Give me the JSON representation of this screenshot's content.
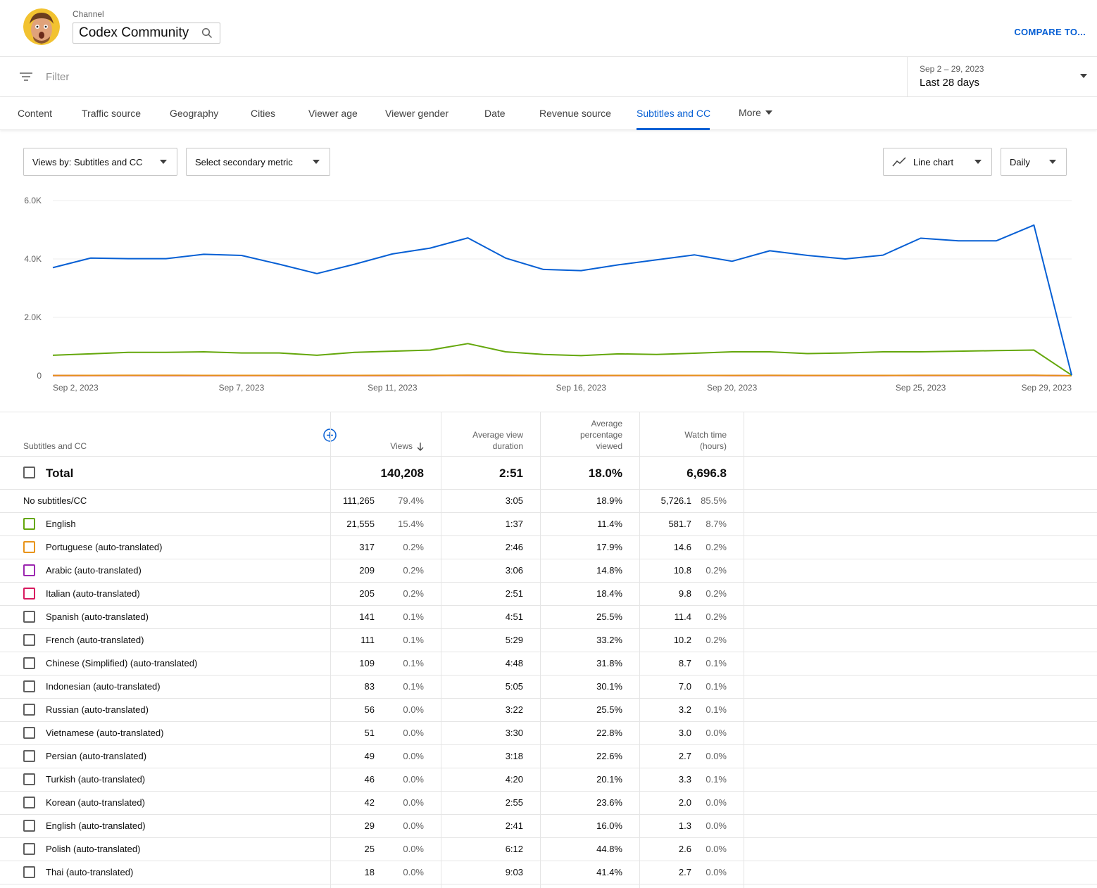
{
  "header": {
    "channel_label": "Channel",
    "channel_name": "Codex Community",
    "compare_label": "COMPARE TO..."
  },
  "filter": {
    "placeholder": "Filter",
    "date_range": "Sep 2 – 29, 2023",
    "date_preset": "Last 28 days"
  },
  "tabs": [
    "Content",
    "Traffic source",
    "Geography",
    "Cities",
    "Viewer age",
    "Viewer gender",
    "Date",
    "Revenue source",
    "Subtitles and CC",
    "More"
  ],
  "active_tab": "Subtitles and CC",
  "controls": {
    "primary_metric": "Views by: Subtitles and CC",
    "secondary_metric": "Select secondary metric",
    "chart_type": "Line chart",
    "interval": "Daily"
  },
  "chart_data": {
    "type": "line",
    "y_ticks": [
      "6.0K",
      "4.0K",
      "2.0K",
      "0"
    ],
    "ylim": [
      0,
      6000
    ],
    "x_tick_labels": [
      "Sep 2, 2023",
      "Sep 7, 2023",
      "Sep 11, 2023",
      "Sep 16, 2023",
      "Sep 20, 2023",
      "Sep 25, 2023",
      "Sep 29, 2023"
    ],
    "x_tick_index": [
      0,
      5,
      9,
      14,
      18,
      23,
      27
    ],
    "x": [
      "Sep 2",
      "Sep 3",
      "Sep 4",
      "Sep 5",
      "Sep 6",
      "Sep 7",
      "Sep 8",
      "Sep 9",
      "Sep 10",
      "Sep 11",
      "Sep 12",
      "Sep 13",
      "Sep 14",
      "Sep 15",
      "Sep 16",
      "Sep 17",
      "Sep 18",
      "Sep 19",
      "Sep 20",
      "Sep 21",
      "Sep 22",
      "Sep 23",
      "Sep 24",
      "Sep 25",
      "Sep 26",
      "Sep 27",
      "Sep 28",
      "Sep 29"
    ],
    "series": [
      {
        "color": "#065fd4",
        "values": [
          3700,
          4030,
          4010,
          4010,
          4160,
          4120,
          3820,
          3500,
          3820,
          4170,
          4370,
          4720,
          4030,
          3640,
          3600,
          3800,
          3970,
          4140,
          3920,
          4280,
          4120,
          4000,
          4130,
          4710,
          4620,
          4620,
          5160,
          20
        ]
      },
      {
        "color": "#64a70b",
        "values": [
          700,
          750,
          800,
          800,
          820,
          780,
          780,
          700,
          800,
          840,
          880,
          1100,
          820,
          730,
          690,
          750,
          730,
          770,
          820,
          820,
          760,
          780,
          820,
          820,
          840,
          860,
          880,
          20
        ]
      },
      {
        "color": "#e8941a",
        "values": [
          10,
          12,
          15,
          14,
          13,
          12,
          11,
          10,
          12,
          14,
          15,
          18,
          14,
          12,
          11,
          12,
          12,
          13,
          12,
          14,
          13,
          12,
          13,
          15,
          15,
          15,
          16,
          0
        ]
      },
      {
        "color": "#9c27b0",
        "values": [
          8,
          9,
          10,
          9,
          8,
          9,
          8,
          7,
          8,
          9,
          10,
          12,
          9,
          8,
          8,
          9,
          9,
          10,
          9,
          10,
          9,
          9,
          9,
          10,
          10,
          10,
          11,
          0
        ]
      },
      {
        "color": "#d81b60",
        "values": [
          7,
          8,
          9,
          8,
          7,
          8,
          7,
          6,
          7,
          8,
          9,
          10,
          8,
          7,
          7,
          8,
          8,
          9,
          8,
          9,
          8,
          8,
          8,
          9,
          9,
          9,
          10,
          0
        ]
      }
    ]
  },
  "table": {
    "headers": {
      "dimension": "Subtitles and CC",
      "views": "Views",
      "avg_duration": [
        "Average view",
        "duration"
      ],
      "avg_pct": [
        "Average",
        "percentage",
        "viewed"
      ],
      "watch_time": [
        "Watch time",
        "(hours)"
      ]
    },
    "total": {
      "label": "Total",
      "views": "140,208",
      "avg_duration": "2:51",
      "avg_pct": "18.0%",
      "watch_time": "6,696.8"
    },
    "rows": [
      {
        "label": "No subtitles/CC",
        "views": "111,265",
        "views_pct": "79.4%",
        "avg_duration": "3:05",
        "avg_pct": "18.9%",
        "watch_time": "5,726.1",
        "watch_pct": "85.5%",
        "checkbox": false,
        "color": ""
      },
      {
        "label": "English",
        "views": "21,555",
        "views_pct": "15.4%",
        "avg_duration": "1:37",
        "avg_pct": "11.4%",
        "watch_time": "581.7",
        "watch_pct": "8.7%",
        "checkbox": true,
        "color": "#64a70b"
      },
      {
        "label": "Portuguese (auto-translated)",
        "views": "317",
        "views_pct": "0.2%",
        "avg_duration": "2:46",
        "avg_pct": "17.9%",
        "watch_time": "14.6",
        "watch_pct": "0.2%",
        "checkbox": true,
        "color": "#e8941a"
      },
      {
        "label": "Arabic (auto-translated)",
        "views": "209",
        "views_pct": "0.2%",
        "avg_duration": "3:06",
        "avg_pct": "14.8%",
        "watch_time": "10.8",
        "watch_pct": "0.2%",
        "checkbox": true,
        "color": "#9c27b0"
      },
      {
        "label": "Italian (auto-translated)",
        "views": "205",
        "views_pct": "0.2%",
        "avg_duration": "2:51",
        "avg_pct": "18.4%",
        "watch_time": "9.8",
        "watch_pct": "0.2%",
        "checkbox": true,
        "color": "#d81b60"
      },
      {
        "label": "Spanish (auto-translated)",
        "views": "141",
        "views_pct": "0.1%",
        "avg_duration": "4:51",
        "avg_pct": "25.5%",
        "watch_time": "11.4",
        "watch_pct": "0.2%",
        "checkbox": true,
        "color": ""
      },
      {
        "label": "French (auto-translated)",
        "views": "111",
        "views_pct": "0.1%",
        "avg_duration": "5:29",
        "avg_pct": "33.2%",
        "watch_time": "10.2",
        "watch_pct": "0.2%",
        "checkbox": true,
        "color": ""
      },
      {
        "label": "Chinese (Simplified) (auto-translated)",
        "views": "109",
        "views_pct": "0.1%",
        "avg_duration": "4:48",
        "avg_pct": "31.8%",
        "watch_time": "8.7",
        "watch_pct": "0.1%",
        "checkbox": true,
        "color": ""
      },
      {
        "label": "Indonesian (auto-translated)",
        "views": "83",
        "views_pct": "0.1%",
        "avg_duration": "5:05",
        "avg_pct": "30.1%",
        "watch_time": "7.0",
        "watch_pct": "0.1%",
        "checkbox": true,
        "color": ""
      },
      {
        "label": "Russian (auto-translated)",
        "views": "56",
        "views_pct": "0.0%",
        "avg_duration": "3:22",
        "avg_pct": "25.5%",
        "watch_time": "3.2",
        "watch_pct": "0.1%",
        "checkbox": true,
        "color": ""
      },
      {
        "label": "Vietnamese (auto-translated)",
        "views": "51",
        "views_pct": "0.0%",
        "avg_duration": "3:30",
        "avg_pct": "22.8%",
        "watch_time": "3.0",
        "watch_pct": "0.0%",
        "checkbox": true,
        "color": ""
      },
      {
        "label": "Persian (auto-translated)",
        "views": "49",
        "views_pct": "0.0%",
        "avg_duration": "3:18",
        "avg_pct": "22.6%",
        "watch_time": "2.7",
        "watch_pct": "0.0%",
        "checkbox": true,
        "color": ""
      },
      {
        "label": "Turkish (auto-translated)",
        "views": "46",
        "views_pct": "0.0%",
        "avg_duration": "4:20",
        "avg_pct": "20.1%",
        "watch_time": "3.3",
        "watch_pct": "0.1%",
        "checkbox": true,
        "color": ""
      },
      {
        "label": "Korean (auto-translated)",
        "views": "42",
        "views_pct": "0.0%",
        "avg_duration": "2:55",
        "avg_pct": "23.6%",
        "watch_time": "2.0",
        "watch_pct": "0.0%",
        "checkbox": true,
        "color": ""
      },
      {
        "label": "English (auto-translated)",
        "views": "29",
        "views_pct": "0.0%",
        "avg_duration": "2:41",
        "avg_pct": "16.0%",
        "watch_time": "1.3",
        "watch_pct": "0.0%",
        "checkbox": true,
        "color": ""
      },
      {
        "label": "Polish (auto-translated)",
        "views": "25",
        "views_pct": "0.0%",
        "avg_duration": "6:12",
        "avg_pct": "44.8%",
        "watch_time": "2.6",
        "watch_pct": "0.0%",
        "checkbox": true,
        "color": ""
      },
      {
        "label": "Thai (auto-translated)",
        "views": "18",
        "views_pct": "0.0%",
        "avg_duration": "9:03",
        "avg_pct": "41.4%",
        "watch_time": "2.7",
        "watch_pct": "0.0%",
        "checkbox": true,
        "color": ""
      }
    ]
  }
}
